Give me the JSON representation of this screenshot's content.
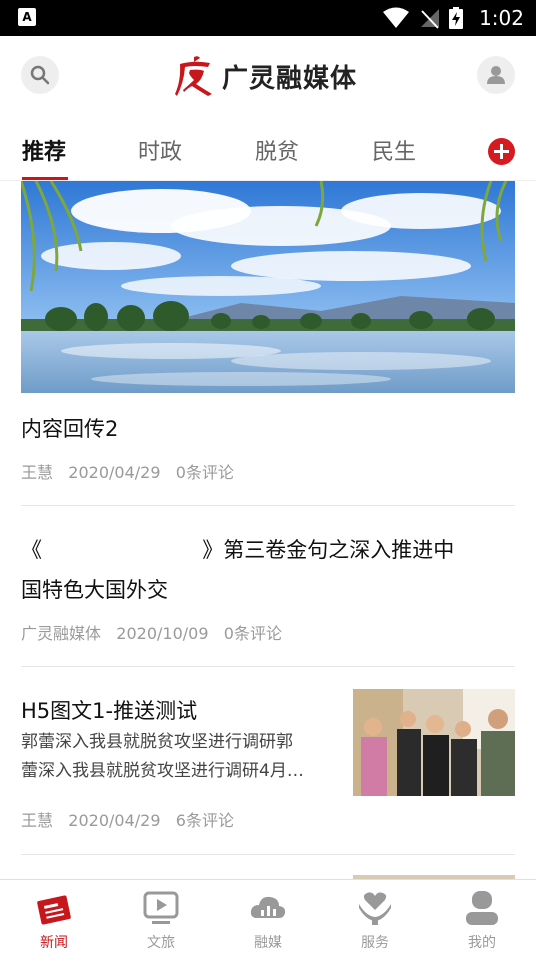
{
  "status_bar": {
    "time": "1:02",
    "left_icon": "A"
  },
  "header": {
    "search_icon": "search-icon",
    "app_name": "广灵融媒体",
    "logo_char": "广",
    "profile_icon": "user-icon"
  },
  "tabs": [
    {
      "label": "推荐",
      "active": true
    },
    {
      "label": "时政",
      "active": false
    },
    {
      "label": "脱贫",
      "active": false
    },
    {
      "label": "民生",
      "active": false
    }
  ],
  "articles": [
    {
      "title": "内容回传2",
      "author": "王慧",
      "date": "2020/04/29",
      "comments": "0条评论"
    },
    {
      "title_line1": "《                        》第三卷金句之深入推进中",
      "title_line2": "国特色大国外交",
      "author": "广灵融媒体",
      "date": "2020/10/09",
      "comments": "0条评论"
    },
    {
      "title": "H5图文1-推送测试",
      "summary_line1": "郭蕾深入我县就脱贫攻坚进行调研郭",
      "summary_line2": "蕾深入我县就脱贫攻坚进行调研4月…",
      "author": "王慧",
      "date": "2020/04/29",
      "comments": "6条评论"
    }
  ],
  "bottom_nav": [
    {
      "label": "新闻",
      "icon": "news-icon",
      "active": true
    },
    {
      "label": "文旅",
      "icon": "play-icon",
      "active": false
    },
    {
      "label": "融媒",
      "icon": "cloud-icon",
      "active": false
    },
    {
      "label": "服务",
      "icon": "heart-hand-icon",
      "active": false
    },
    {
      "label": "我的",
      "icon": "user-icon",
      "active": false
    }
  ],
  "colors": {
    "accent": "#c8161d",
    "inactive": "#9a9a9a"
  }
}
